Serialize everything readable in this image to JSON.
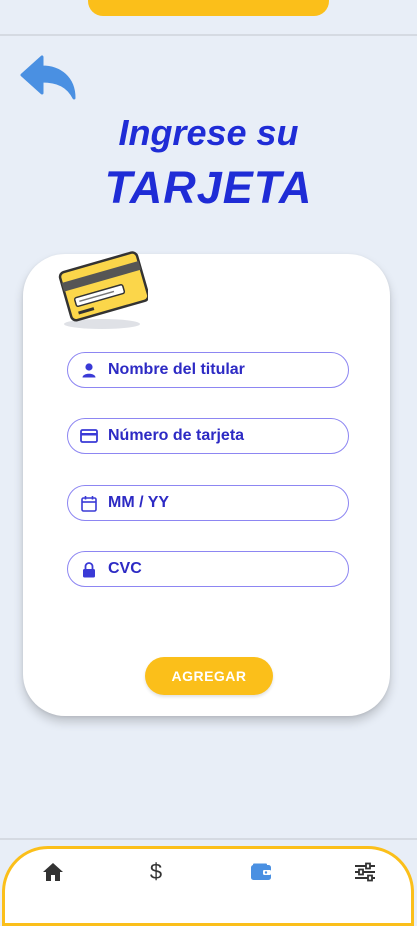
{
  "header": {
    "title_line1": "Ingrese su",
    "title_line2": "TARJETA"
  },
  "form": {
    "holder_placeholder": "Nombre del titular",
    "number_placeholder": "Número de tarjeta",
    "expiry_placeholder": "MM / YY",
    "cvc_placeholder": "CVC",
    "submit_label": "AGREGAR"
  },
  "nav": {
    "items": [
      {
        "icon": "home-icon"
      },
      {
        "icon": "dollar-icon",
        "glyph": "$"
      },
      {
        "icon": "wallet-icon",
        "active": true
      },
      {
        "icon": "sliders-icon"
      }
    ]
  },
  "colors": {
    "accent": "#fbbf1a",
    "title_blue": "#1f2cd6",
    "field_border": "#8d86f2",
    "field_text": "#2d2ac4",
    "back_arrow": "#4a90e2"
  }
}
